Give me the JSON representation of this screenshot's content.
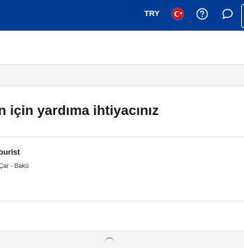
{
  "header": {
    "currency": "TRY",
    "language_flag_icon": "turkey-flag-icon",
    "help_icon": "question-circle-icon",
    "chat_icon": "chat-bubble-icon",
    "background_color": "#003b95"
  },
  "main": {
    "title": "n için yardıma ihtiyacınız",
    "booking": {
      "name": "ourist",
      "location": "Çar - Bakü"
    }
  }
}
